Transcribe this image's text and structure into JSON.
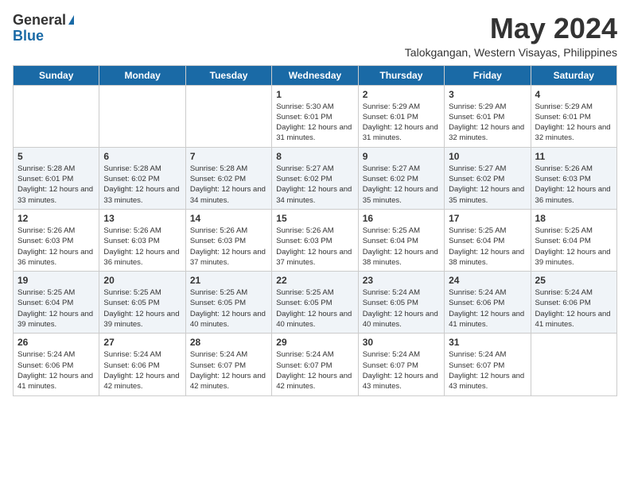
{
  "header": {
    "logo_general": "General",
    "logo_blue": "Blue",
    "title": "May 2024",
    "location": "Talokgangan, Western Visayas, Philippines"
  },
  "days_of_week": [
    "Sunday",
    "Monday",
    "Tuesday",
    "Wednesday",
    "Thursday",
    "Friday",
    "Saturday"
  ],
  "weeks": [
    [
      {
        "day": "",
        "sunrise": "",
        "sunset": "",
        "daylight": ""
      },
      {
        "day": "",
        "sunrise": "",
        "sunset": "",
        "daylight": ""
      },
      {
        "day": "",
        "sunrise": "",
        "sunset": "",
        "daylight": ""
      },
      {
        "day": "1",
        "sunrise": "Sunrise: 5:30 AM",
        "sunset": "Sunset: 6:01 PM",
        "daylight": "Daylight: 12 hours and 31 minutes."
      },
      {
        "day": "2",
        "sunrise": "Sunrise: 5:29 AM",
        "sunset": "Sunset: 6:01 PM",
        "daylight": "Daylight: 12 hours and 31 minutes."
      },
      {
        "day": "3",
        "sunrise": "Sunrise: 5:29 AM",
        "sunset": "Sunset: 6:01 PM",
        "daylight": "Daylight: 12 hours and 32 minutes."
      },
      {
        "day": "4",
        "sunrise": "Sunrise: 5:29 AM",
        "sunset": "Sunset: 6:01 PM",
        "daylight": "Daylight: 12 hours and 32 minutes."
      }
    ],
    [
      {
        "day": "5",
        "sunrise": "Sunrise: 5:28 AM",
        "sunset": "Sunset: 6:01 PM",
        "daylight": "Daylight: 12 hours and 33 minutes."
      },
      {
        "day": "6",
        "sunrise": "Sunrise: 5:28 AM",
        "sunset": "Sunset: 6:02 PM",
        "daylight": "Daylight: 12 hours and 33 minutes."
      },
      {
        "day": "7",
        "sunrise": "Sunrise: 5:28 AM",
        "sunset": "Sunset: 6:02 PM",
        "daylight": "Daylight: 12 hours and 34 minutes."
      },
      {
        "day": "8",
        "sunrise": "Sunrise: 5:27 AM",
        "sunset": "Sunset: 6:02 PM",
        "daylight": "Daylight: 12 hours and 34 minutes."
      },
      {
        "day": "9",
        "sunrise": "Sunrise: 5:27 AM",
        "sunset": "Sunset: 6:02 PM",
        "daylight": "Daylight: 12 hours and 35 minutes."
      },
      {
        "day": "10",
        "sunrise": "Sunrise: 5:27 AM",
        "sunset": "Sunset: 6:02 PM",
        "daylight": "Daylight: 12 hours and 35 minutes."
      },
      {
        "day": "11",
        "sunrise": "Sunrise: 5:26 AM",
        "sunset": "Sunset: 6:03 PM",
        "daylight": "Daylight: 12 hours and 36 minutes."
      }
    ],
    [
      {
        "day": "12",
        "sunrise": "Sunrise: 5:26 AM",
        "sunset": "Sunset: 6:03 PM",
        "daylight": "Daylight: 12 hours and 36 minutes."
      },
      {
        "day": "13",
        "sunrise": "Sunrise: 5:26 AM",
        "sunset": "Sunset: 6:03 PM",
        "daylight": "Daylight: 12 hours and 36 minutes."
      },
      {
        "day": "14",
        "sunrise": "Sunrise: 5:26 AM",
        "sunset": "Sunset: 6:03 PM",
        "daylight": "Daylight: 12 hours and 37 minutes."
      },
      {
        "day": "15",
        "sunrise": "Sunrise: 5:26 AM",
        "sunset": "Sunset: 6:03 PM",
        "daylight": "Daylight: 12 hours and 37 minutes."
      },
      {
        "day": "16",
        "sunrise": "Sunrise: 5:25 AM",
        "sunset": "Sunset: 6:04 PM",
        "daylight": "Daylight: 12 hours and 38 minutes."
      },
      {
        "day": "17",
        "sunrise": "Sunrise: 5:25 AM",
        "sunset": "Sunset: 6:04 PM",
        "daylight": "Daylight: 12 hours and 38 minutes."
      },
      {
        "day": "18",
        "sunrise": "Sunrise: 5:25 AM",
        "sunset": "Sunset: 6:04 PM",
        "daylight": "Daylight: 12 hours and 39 minutes."
      }
    ],
    [
      {
        "day": "19",
        "sunrise": "Sunrise: 5:25 AM",
        "sunset": "Sunset: 6:04 PM",
        "daylight": "Daylight: 12 hours and 39 minutes."
      },
      {
        "day": "20",
        "sunrise": "Sunrise: 5:25 AM",
        "sunset": "Sunset: 6:05 PM",
        "daylight": "Daylight: 12 hours and 39 minutes."
      },
      {
        "day": "21",
        "sunrise": "Sunrise: 5:25 AM",
        "sunset": "Sunset: 6:05 PM",
        "daylight": "Daylight: 12 hours and 40 minutes."
      },
      {
        "day": "22",
        "sunrise": "Sunrise: 5:25 AM",
        "sunset": "Sunset: 6:05 PM",
        "daylight": "Daylight: 12 hours and 40 minutes."
      },
      {
        "day": "23",
        "sunrise": "Sunrise: 5:24 AM",
        "sunset": "Sunset: 6:05 PM",
        "daylight": "Daylight: 12 hours and 40 minutes."
      },
      {
        "day": "24",
        "sunrise": "Sunrise: 5:24 AM",
        "sunset": "Sunset: 6:06 PM",
        "daylight": "Daylight: 12 hours and 41 minutes."
      },
      {
        "day": "25",
        "sunrise": "Sunrise: 5:24 AM",
        "sunset": "Sunset: 6:06 PM",
        "daylight": "Daylight: 12 hours and 41 minutes."
      }
    ],
    [
      {
        "day": "26",
        "sunrise": "Sunrise: 5:24 AM",
        "sunset": "Sunset: 6:06 PM",
        "daylight": "Daylight: 12 hours and 41 minutes."
      },
      {
        "day": "27",
        "sunrise": "Sunrise: 5:24 AM",
        "sunset": "Sunset: 6:06 PM",
        "daylight": "Daylight: 12 hours and 42 minutes."
      },
      {
        "day": "28",
        "sunrise": "Sunrise: 5:24 AM",
        "sunset": "Sunset: 6:07 PM",
        "daylight": "Daylight: 12 hours and 42 minutes."
      },
      {
        "day": "29",
        "sunrise": "Sunrise: 5:24 AM",
        "sunset": "Sunset: 6:07 PM",
        "daylight": "Daylight: 12 hours and 42 minutes."
      },
      {
        "day": "30",
        "sunrise": "Sunrise: 5:24 AM",
        "sunset": "Sunset: 6:07 PM",
        "daylight": "Daylight: 12 hours and 43 minutes."
      },
      {
        "day": "31",
        "sunrise": "Sunrise: 5:24 AM",
        "sunset": "Sunset: 6:07 PM",
        "daylight": "Daylight: 12 hours and 43 minutes."
      },
      {
        "day": "",
        "sunrise": "",
        "sunset": "",
        "daylight": ""
      }
    ]
  ]
}
